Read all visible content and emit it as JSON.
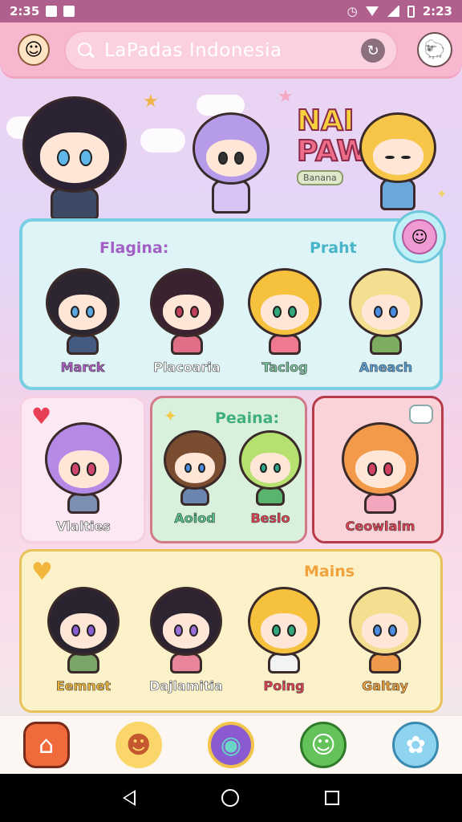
{
  "status_bar": {
    "time": "2:35",
    "right_text": "2:23"
  },
  "search": {
    "query": "LaPadas Indonesia"
  },
  "hero_logo": {
    "line1": "NAI",
    "line2": "PAW",
    "badge": "Banana"
  },
  "section_top": {
    "header_left": "Flagina:",
    "header_right": "Praht",
    "characters": [
      "Marck",
      "Placoaria",
      "Taclog",
      "Aneach"
    ]
  },
  "section_middle": {
    "left_character": "Vlalties",
    "center_header": "Peaina:",
    "center_characters": [
      "Aoiod",
      "Beslo"
    ],
    "right_character": "Ceowlaim"
  },
  "section_bottom": {
    "header": "Mains",
    "characters": [
      "Eemnet",
      "Dajlamitia",
      "Poing",
      "Galtay"
    ]
  },
  "bottom_nav": {
    "items": [
      "house-icon",
      "smiley-icon",
      "globe-icon",
      "chat-icon",
      "mascot-icon"
    ]
  },
  "colors": {
    "top_panel": "#def4f7",
    "accent_pink": "#f7b7cf",
    "gold_panel": "#fbf2c9",
    "red_panel": "#f9d3d7"
  }
}
